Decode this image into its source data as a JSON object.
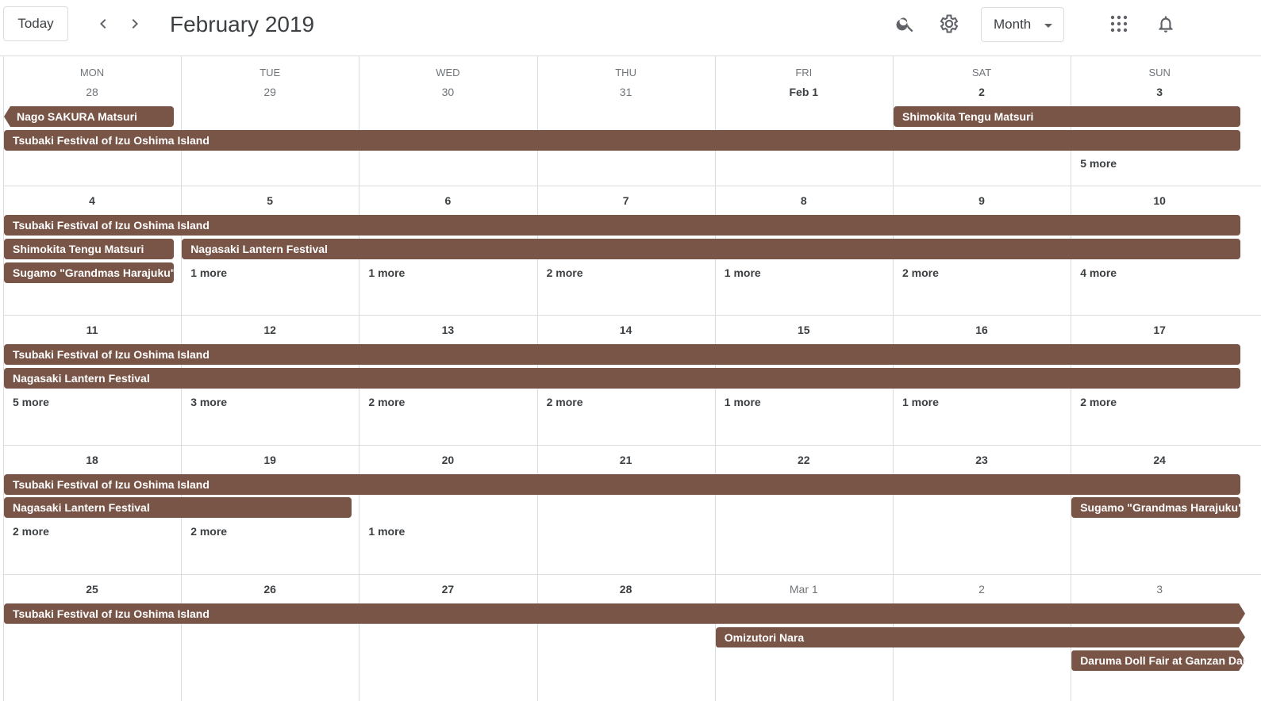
{
  "header": {
    "today_label": "Today",
    "title": "February 2019",
    "view_label": "Month",
    "icons": [
      "chevron-left-icon",
      "chevron-right-icon",
      "search-icon",
      "gear-icon",
      "apps-grid-icon",
      "bell-icon"
    ]
  },
  "colors": {
    "event": "#795548",
    "border": "#dadce0",
    "text": "#3c4043",
    "muted": "#70757a"
  },
  "weekdays": [
    "MON",
    "TUE",
    "WED",
    "THU",
    "FRI",
    "SAT",
    "SUN"
  ],
  "weeks": [
    {
      "days": [
        {
          "label": "28",
          "other": true
        },
        {
          "label": "29",
          "other": true
        },
        {
          "label": "30",
          "other": true
        },
        {
          "label": "31",
          "other": true
        },
        {
          "label": "Feb 1",
          "other": false
        },
        {
          "label": "2",
          "other": false
        },
        {
          "label": "3",
          "other": false
        }
      ],
      "events": [
        {
          "title": "Nago SAKURA Matsuri",
          "start": 0,
          "span": 1,
          "lane": 0,
          "cont_left": true
        },
        {
          "title": "Shimokita Tengu Matsuri",
          "start": 5,
          "span": 2,
          "lane": 0
        },
        {
          "title": "Tsubaki Festival of Izu Oshima Island",
          "start": 0,
          "span": 7,
          "lane": 1
        }
      ],
      "more": [
        {
          "day": 6,
          "lane": 2,
          "label": "5 more"
        }
      ]
    },
    {
      "days": [
        {
          "label": "4"
        },
        {
          "label": "5"
        },
        {
          "label": "6"
        },
        {
          "label": "7"
        },
        {
          "label": "8"
        },
        {
          "label": "9"
        },
        {
          "label": "10"
        }
      ],
      "events": [
        {
          "title": "Tsubaki Festival of Izu Oshima Island",
          "start": 0,
          "span": 7,
          "lane": 0
        },
        {
          "title": "Shimokita Tengu Matsuri",
          "start": 0,
          "span": 1,
          "lane": 1
        },
        {
          "title": "Nagasaki Lantern Festival",
          "start": 1,
          "span": 6,
          "lane": 1
        },
        {
          "title": "Sugamo \"Grandmas Harajuku\"",
          "start": 0,
          "span": 1,
          "lane": 2
        }
      ],
      "more": [
        {
          "day": 1,
          "lane": 2,
          "label": "1 more"
        },
        {
          "day": 2,
          "lane": 2,
          "label": "1 more"
        },
        {
          "day": 3,
          "lane": 2,
          "label": "2 more"
        },
        {
          "day": 4,
          "lane": 2,
          "label": "1 more"
        },
        {
          "day": 5,
          "lane": 2,
          "label": "2 more"
        },
        {
          "day": 6,
          "lane": 2,
          "label": "4 more"
        }
      ]
    },
    {
      "days": [
        {
          "label": "11"
        },
        {
          "label": "12"
        },
        {
          "label": "13"
        },
        {
          "label": "14"
        },
        {
          "label": "15"
        },
        {
          "label": "16"
        },
        {
          "label": "17"
        }
      ],
      "events": [
        {
          "title": "Tsubaki Festival of Izu Oshima Island",
          "start": 0,
          "span": 7,
          "lane": 0
        },
        {
          "title": "Nagasaki Lantern Festival",
          "start": 0,
          "span": 7,
          "lane": 1
        }
      ],
      "more": [
        {
          "day": 0,
          "lane": 2,
          "label": "5 more"
        },
        {
          "day": 1,
          "lane": 2,
          "label": "3 more"
        },
        {
          "day": 2,
          "lane": 2,
          "label": "2 more"
        },
        {
          "day": 3,
          "lane": 2,
          "label": "2 more"
        },
        {
          "day": 4,
          "lane": 2,
          "label": "1 more"
        },
        {
          "day": 5,
          "lane": 2,
          "label": "1 more"
        },
        {
          "day": 6,
          "lane": 2,
          "label": "2 more"
        }
      ]
    },
    {
      "days": [
        {
          "label": "18"
        },
        {
          "label": "19"
        },
        {
          "label": "20"
        },
        {
          "label": "21"
        },
        {
          "label": "22"
        },
        {
          "label": "23"
        },
        {
          "label": "24"
        }
      ],
      "events": [
        {
          "title": "Tsubaki Festival of Izu Oshima Island",
          "start": 0,
          "span": 7,
          "lane": 0
        },
        {
          "title": "Nagasaki Lantern Festival",
          "start": 0,
          "span": 2,
          "lane": 1
        },
        {
          "title": "Sugamo \"Grandmas Harajuku\"",
          "start": 6,
          "span": 1,
          "lane": 1
        }
      ],
      "more": [
        {
          "day": 0,
          "lane": 2,
          "label": "2 more"
        },
        {
          "day": 1,
          "lane": 2,
          "label": "2 more"
        },
        {
          "day": 2,
          "lane": 2,
          "label": "1 more"
        }
      ]
    },
    {
      "days": [
        {
          "label": "25"
        },
        {
          "label": "26"
        },
        {
          "label": "27"
        },
        {
          "label": "28"
        },
        {
          "label": "Mar 1",
          "other": true
        },
        {
          "label": "2",
          "other": true
        },
        {
          "label": "3",
          "other": true
        }
      ],
      "events": [
        {
          "title": "Tsubaki Festival of Izu Oshima Island",
          "start": 0,
          "span": 7,
          "lane": 0,
          "cont_right": true
        },
        {
          "title": "Omizutori Nara",
          "start": 4,
          "span": 3,
          "lane": 1,
          "cont_right": true
        },
        {
          "title": "Daruma Doll Fair at Ganzan Daishi-do Temple",
          "start": 6,
          "span": 1,
          "lane": 2,
          "cont_right": true
        }
      ],
      "more": []
    }
  ]
}
